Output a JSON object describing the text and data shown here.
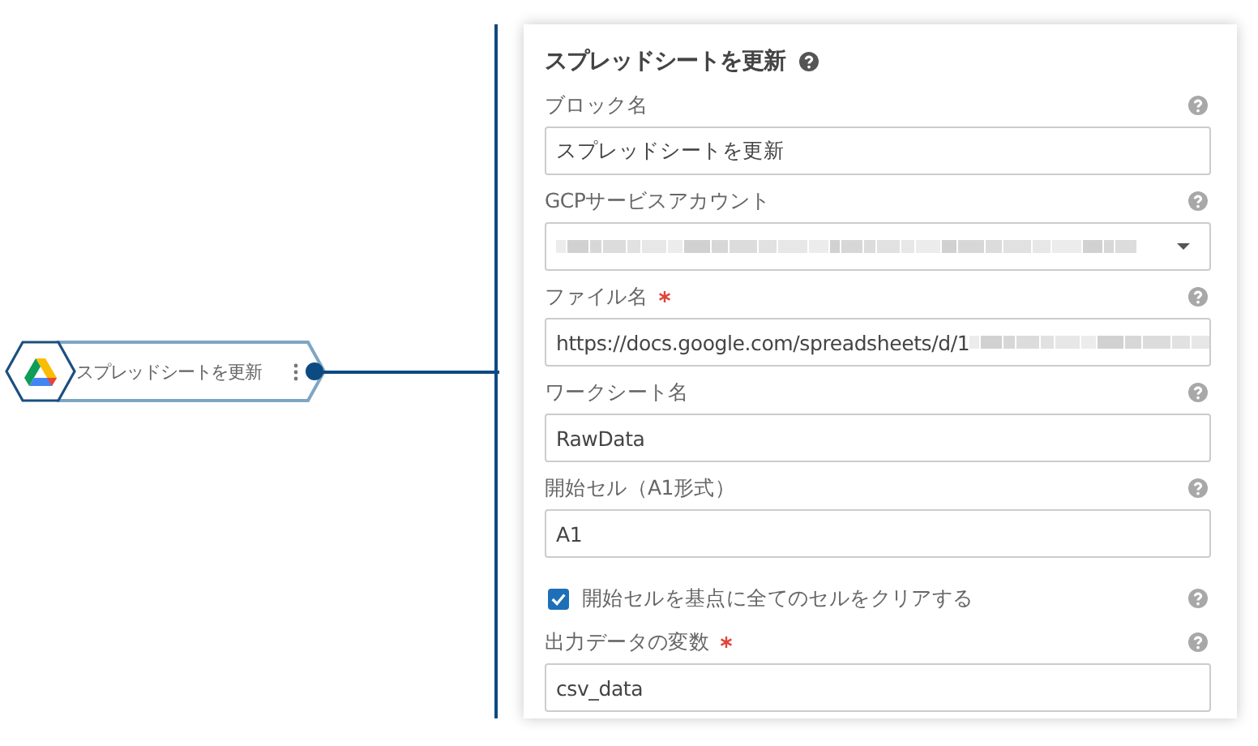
{
  "node": {
    "label": "スプレッドシートを更新"
  },
  "panel": {
    "title": "スプレッドシートを更新"
  },
  "fields": [
    {
      "kind": "text",
      "label": "ブロック名",
      "required": false,
      "value": "スプレッドシートを更新"
    },
    {
      "kind": "select",
      "label": "GCPサービスアカウント",
      "required": false,
      "redacted": true
    },
    {
      "kind": "text",
      "label": "ファイル名",
      "required": true,
      "value": "https://docs.google.com/spreadsheets/d/1",
      "redacted": true
    },
    {
      "kind": "text",
      "label": "ワークシート名",
      "required": false,
      "value": "RawData"
    },
    {
      "kind": "text",
      "label": "開始セル（A1形式）",
      "required": false,
      "value": "A1"
    },
    {
      "kind": "checkbox",
      "label": "開始セルを基点に全てのセルをクリアする",
      "checked": true
    },
    {
      "kind": "text",
      "label": "出力データの変数",
      "required": true,
      "value": "csv_data"
    }
  ]
}
